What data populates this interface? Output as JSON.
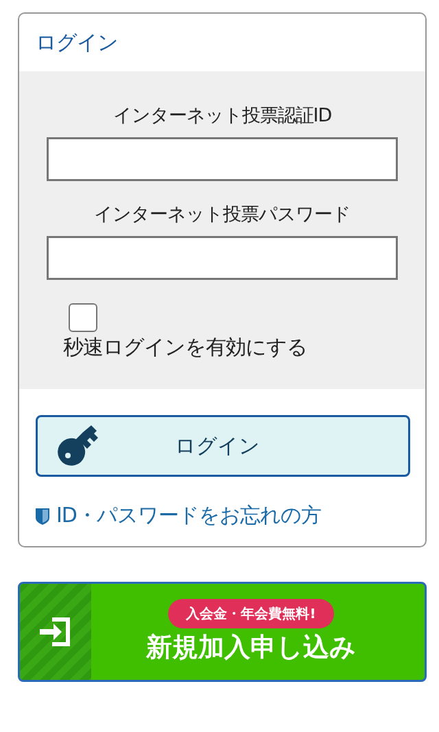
{
  "login_panel": {
    "title": "ログイン",
    "fields": [
      {
        "label": "インターネット投票認証ID"
      },
      {
        "label": "インターネット投票パスワード"
      }
    ],
    "quick_login": {
      "label": "秒速ログインを有効にする",
      "checked": false
    },
    "login_button": "ログイン",
    "forgot_link": "ID・パスワードをお忘れの方"
  },
  "signup_button": {
    "badge": "入会金・年会費無料!",
    "label": "新規加入申し込み"
  }
}
